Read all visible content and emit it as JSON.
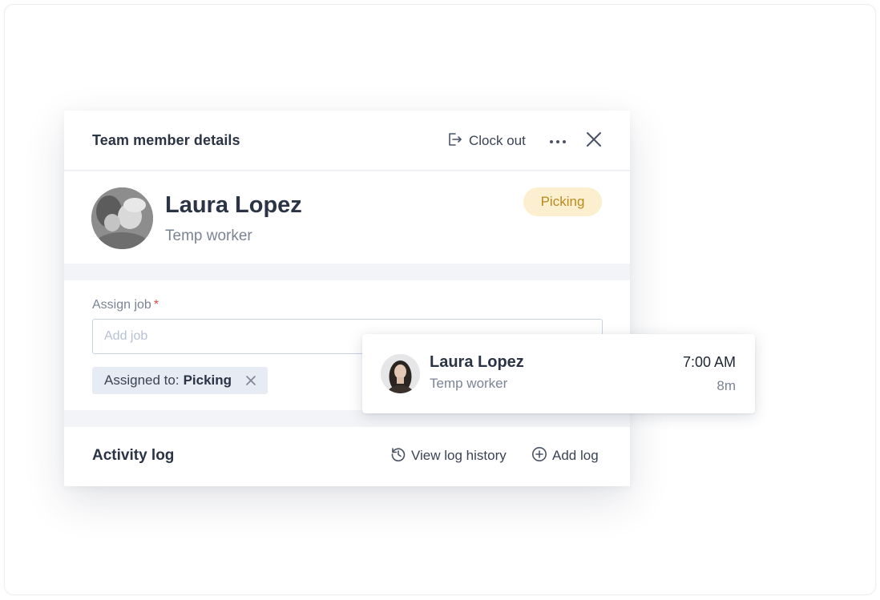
{
  "panel": {
    "title": "Team member details",
    "clock_out_label": "Clock out"
  },
  "profile": {
    "name": "Laura Lopez",
    "role": "Temp worker",
    "status": "Picking"
  },
  "assign": {
    "label": "Assign job",
    "required_mark": "*",
    "placeholder": "Add job",
    "value": "",
    "chip_prefix": "Assigned to:",
    "chip_value": "Picking"
  },
  "activity": {
    "title": "Activity log",
    "view_history_label": "View log history",
    "add_log_label": "Add log"
  },
  "popup": {
    "name": "Laura Lopez",
    "role": "Temp worker",
    "time": "7:00 AM",
    "duration": "8m"
  },
  "colors": {
    "badge_bg": "#fcefcf",
    "badge_text": "#b98a1e",
    "required": "#e2474b",
    "input_border": "#c8d0e6",
    "chip_bg": "#e7ebf3"
  },
  "icons": {
    "clock_out": "clock-out-icon",
    "more": "more-icon",
    "close": "close-icon",
    "chip_remove": "close-icon",
    "view_history": "history-icon",
    "add_log": "plus-circle-icon"
  }
}
